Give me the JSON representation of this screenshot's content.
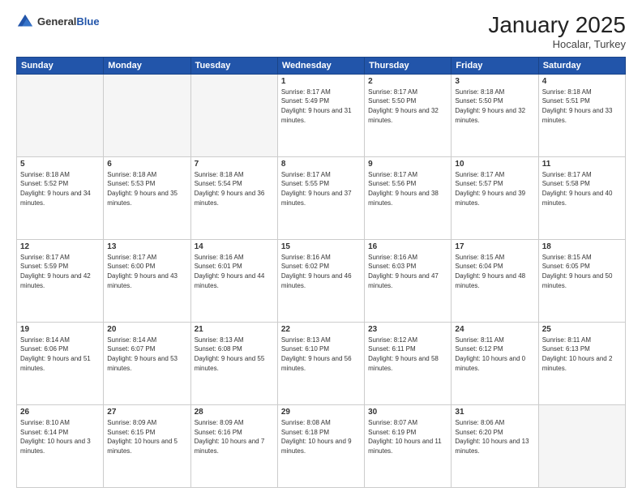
{
  "header": {
    "logo_general": "General",
    "logo_blue": "Blue",
    "month_title": "January 2025",
    "location": "Hocalar, Turkey"
  },
  "weekdays": [
    "Sunday",
    "Monday",
    "Tuesday",
    "Wednesday",
    "Thursday",
    "Friday",
    "Saturday"
  ],
  "weeks": [
    [
      {
        "day": "",
        "empty": true
      },
      {
        "day": "",
        "empty": true
      },
      {
        "day": "",
        "empty": true
      },
      {
        "day": "1",
        "sunrise": "8:17 AM",
        "sunset": "5:49 PM",
        "daylight": "9 hours and 31 minutes."
      },
      {
        "day": "2",
        "sunrise": "8:17 AM",
        "sunset": "5:50 PM",
        "daylight": "9 hours and 32 minutes."
      },
      {
        "day": "3",
        "sunrise": "8:18 AM",
        "sunset": "5:50 PM",
        "daylight": "9 hours and 32 minutes."
      },
      {
        "day": "4",
        "sunrise": "8:18 AM",
        "sunset": "5:51 PM",
        "daylight": "9 hours and 33 minutes."
      }
    ],
    [
      {
        "day": "5",
        "sunrise": "8:18 AM",
        "sunset": "5:52 PM",
        "daylight": "9 hours and 34 minutes."
      },
      {
        "day": "6",
        "sunrise": "8:18 AM",
        "sunset": "5:53 PM",
        "daylight": "9 hours and 35 minutes."
      },
      {
        "day": "7",
        "sunrise": "8:18 AM",
        "sunset": "5:54 PM",
        "daylight": "9 hours and 36 minutes."
      },
      {
        "day": "8",
        "sunrise": "8:17 AM",
        "sunset": "5:55 PM",
        "daylight": "9 hours and 37 minutes."
      },
      {
        "day": "9",
        "sunrise": "8:17 AM",
        "sunset": "5:56 PM",
        "daylight": "9 hours and 38 minutes."
      },
      {
        "day": "10",
        "sunrise": "8:17 AM",
        "sunset": "5:57 PM",
        "daylight": "9 hours and 39 minutes."
      },
      {
        "day": "11",
        "sunrise": "8:17 AM",
        "sunset": "5:58 PM",
        "daylight": "9 hours and 40 minutes."
      }
    ],
    [
      {
        "day": "12",
        "sunrise": "8:17 AM",
        "sunset": "5:59 PM",
        "daylight": "9 hours and 42 minutes."
      },
      {
        "day": "13",
        "sunrise": "8:17 AM",
        "sunset": "6:00 PM",
        "daylight": "9 hours and 43 minutes."
      },
      {
        "day": "14",
        "sunrise": "8:16 AM",
        "sunset": "6:01 PM",
        "daylight": "9 hours and 44 minutes."
      },
      {
        "day": "15",
        "sunrise": "8:16 AM",
        "sunset": "6:02 PM",
        "daylight": "9 hours and 46 minutes."
      },
      {
        "day": "16",
        "sunrise": "8:16 AM",
        "sunset": "6:03 PM",
        "daylight": "9 hours and 47 minutes."
      },
      {
        "day": "17",
        "sunrise": "8:15 AM",
        "sunset": "6:04 PM",
        "daylight": "9 hours and 48 minutes."
      },
      {
        "day": "18",
        "sunrise": "8:15 AM",
        "sunset": "6:05 PM",
        "daylight": "9 hours and 50 minutes."
      }
    ],
    [
      {
        "day": "19",
        "sunrise": "8:14 AM",
        "sunset": "6:06 PM",
        "daylight": "9 hours and 51 minutes."
      },
      {
        "day": "20",
        "sunrise": "8:14 AM",
        "sunset": "6:07 PM",
        "daylight": "9 hours and 53 minutes."
      },
      {
        "day": "21",
        "sunrise": "8:13 AM",
        "sunset": "6:08 PM",
        "daylight": "9 hours and 55 minutes."
      },
      {
        "day": "22",
        "sunrise": "8:13 AM",
        "sunset": "6:10 PM",
        "daylight": "9 hours and 56 minutes."
      },
      {
        "day": "23",
        "sunrise": "8:12 AM",
        "sunset": "6:11 PM",
        "daylight": "9 hours and 58 minutes."
      },
      {
        "day": "24",
        "sunrise": "8:11 AM",
        "sunset": "6:12 PM",
        "daylight": "10 hours and 0 minutes."
      },
      {
        "day": "25",
        "sunrise": "8:11 AM",
        "sunset": "6:13 PM",
        "daylight": "10 hours and 2 minutes."
      }
    ],
    [
      {
        "day": "26",
        "sunrise": "8:10 AM",
        "sunset": "6:14 PM",
        "daylight": "10 hours and 3 minutes."
      },
      {
        "day": "27",
        "sunrise": "8:09 AM",
        "sunset": "6:15 PM",
        "daylight": "10 hours and 5 minutes."
      },
      {
        "day": "28",
        "sunrise": "8:09 AM",
        "sunset": "6:16 PM",
        "daylight": "10 hours and 7 minutes."
      },
      {
        "day": "29",
        "sunrise": "8:08 AM",
        "sunset": "6:18 PM",
        "daylight": "10 hours and 9 minutes."
      },
      {
        "day": "30",
        "sunrise": "8:07 AM",
        "sunset": "6:19 PM",
        "daylight": "10 hours and 11 minutes."
      },
      {
        "day": "31",
        "sunrise": "8:06 AM",
        "sunset": "6:20 PM",
        "daylight": "10 hours and 13 minutes."
      },
      {
        "day": "",
        "empty": true
      }
    ]
  ],
  "labels": {
    "sunrise": "Sunrise:",
    "sunset": "Sunset:",
    "daylight": "Daylight:"
  }
}
